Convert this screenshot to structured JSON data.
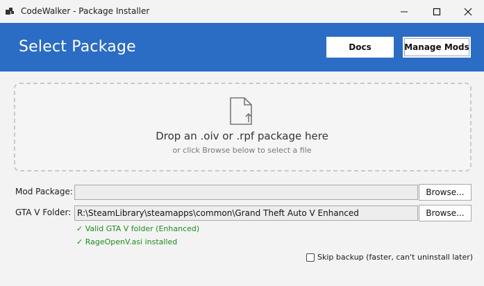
{
  "window": {
    "title": "CodeWalker - Package Installer"
  },
  "header": {
    "title": "Select Package",
    "docs_label": "Docs",
    "manage_mods_label": "Manage Mods",
    "background": "#2b6cc4"
  },
  "dropzone": {
    "icon": "file-upload-icon",
    "main_text": "Drop an .oiv or .rpf package here",
    "sub_text": "or click Browse below to select a file"
  },
  "fields": {
    "mod_package": {
      "label": "Mod Package:",
      "value": "",
      "browse_label": "Browse..."
    },
    "gta_folder": {
      "label": "GTA V Folder:",
      "value": "R:\\SteamLibrary\\steamapps\\common\\Grand Theft Auto V Enhanced",
      "browse_label": "Browse..."
    }
  },
  "status": {
    "folder_valid": "✓ Valid GTA V folder (Enhanced)",
    "rageopenv": "✓ RageOpenV.asi installed",
    "color": "#1e8a1e"
  },
  "options": {
    "skip_backup_label": "Skip backup (faster, can't uninstall later)",
    "skip_backup_checked": false
  }
}
